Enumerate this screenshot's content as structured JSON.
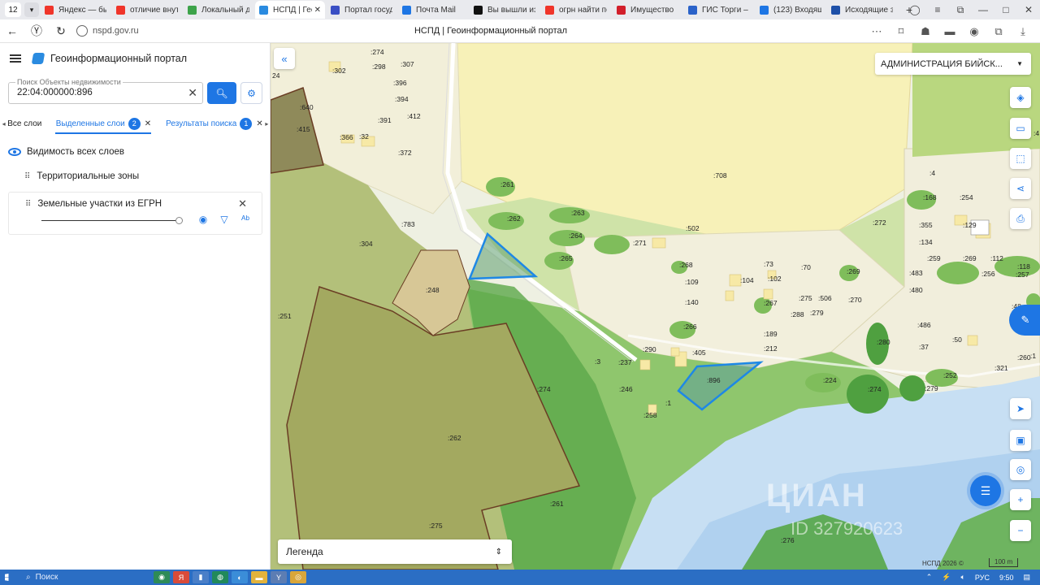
{
  "browser": {
    "tab_count": "12",
    "tabs": [
      {
        "title": "Яндекс — быс",
        "color": "#f0352a"
      },
      {
        "title": "отличие внут",
        "color": "#f0352a"
      },
      {
        "title": "Локальный д",
        "color": "#3da34a"
      },
      {
        "title": "НСПД | Гео",
        "color": "#2a8be0",
        "active": true
      },
      {
        "title": "Портал госуд",
        "color": "#3a4fc4"
      },
      {
        "title": "Почта Mail",
        "color": "#1e76e4"
      },
      {
        "title": "Вы вышли из",
        "color": "#111111"
      },
      {
        "title": "огрн найти по",
        "color": "#f0352a"
      },
      {
        "title": "Имущество",
        "color": "#d21f2b"
      },
      {
        "title": "ГИС Торги – г",
        "color": "#2a62c9"
      },
      {
        "title": "(123) Входящ",
        "color": "#1e76e4"
      },
      {
        "title": "Исходящие з",
        "color": "#1e50a8"
      }
    ],
    "url": "nspd.gov.ru",
    "page_title": "НСПД | Геоинформационный портал"
  },
  "panel": {
    "title": "Геоинформационный портал",
    "search": {
      "label": "Поиск Объекты недвижимости",
      "value": "22:04:000000:896"
    },
    "tabs": {
      "all": "Все слои",
      "selected": "Выделенные слои",
      "selected_count": "2",
      "results": "Результаты поиска",
      "results_count": "1"
    },
    "visibility_all": "Видимость всех слоев",
    "layers": {
      "zones": "Территориальные зоны",
      "parcels": "Земельные участки из ЕГРН"
    }
  },
  "map": {
    "region": "АДМИНИСТРАЦИЯ БИЙСК...",
    "legend": "Легенда",
    "copyright": "НСПД 2026 ©",
    "scale": "100 m",
    "watermark": "ЦИАН",
    "watermark_id": "ID 327920623",
    "selected_parcel": ":896",
    "parcel_labels": [
      ":274",
      ":307",
      ":302",
      ":298",
      ":396",
      ":394",
      ":412",
      ":391",
      ":366",
      ":32",
      ":372",
      ":640",
      ":415",
      "24",
      ":708",
      ":261",
      ":262",
      ":263",
      ":264",
      ":265",
      ":271",
      ":502",
      ":783",
      ":304",
      ":248",
      ":268",
      ":109",
      ":73",
      ":104",
      ":102",
      ":70",
      ":269",
      ":272",
      ":140",
      ":267",
      ":275",
      ":506",
      ":270",
      ":288",
      ":279",
      ":266",
      ":189",
      ":212",
      ":251",
      ":405",
      ":290",
      ":237",
      ":3",
      ":246",
      ":1",
      ":258",
      ":274",
      ":321",
      ":224",
      ":274",
      ":280",
      ":279",
      ":262",
      ":252",
      ":261",
      ":275",
      ":276",
      ":4",
      ":168",
      ":254",
      ":355",
      ":129",
      ":134",
      ":259",
      ":269",
      ":112",
      ":118",
      ":256",
      ":257",
      ":483",
      ":480",
      ":486",
      ":50",
      ":37",
      ":260",
      ":1",
      ":27",
      ":48",
      ":4",
      ":13"
    ]
  },
  "taskbar": {
    "search": "Поиск",
    "lang": "РУС",
    "time": "9:50"
  }
}
